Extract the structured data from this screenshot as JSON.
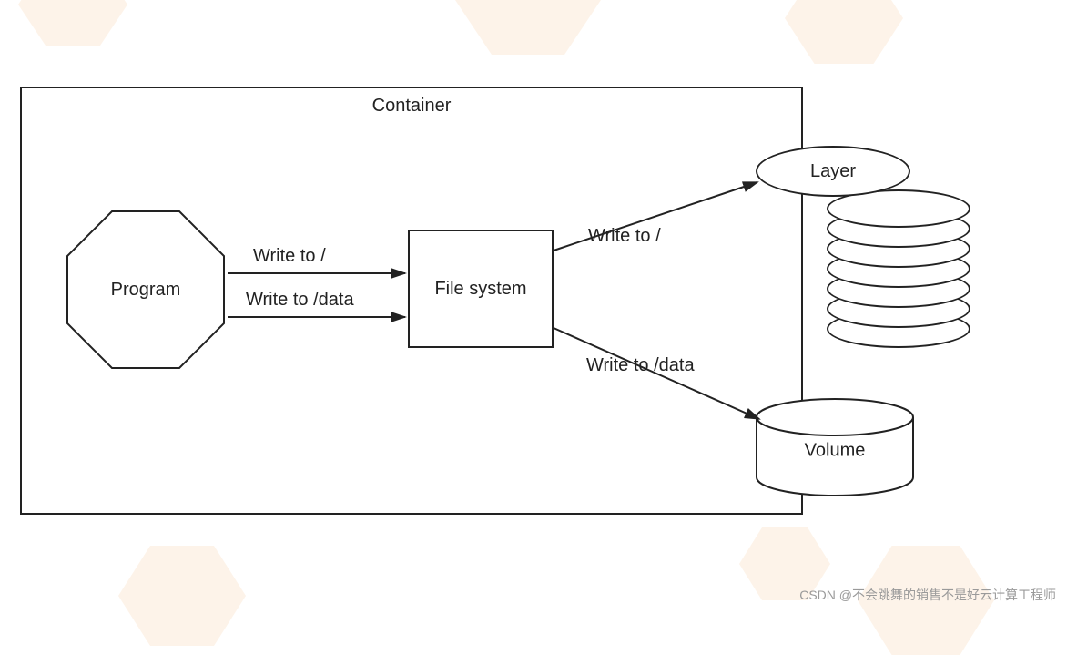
{
  "diagram": {
    "container_label": "Container",
    "nodes": {
      "program": "Program",
      "filesystem": "File system",
      "layer": "Layer",
      "volume": "Volume"
    },
    "edges": {
      "program_to_fs_root": "Write to /",
      "program_to_fs_data": "Write to /data",
      "fs_to_layer": "Write to /",
      "fs_to_volume": "Write to /data"
    }
  },
  "watermark": "CSDN @不会跳舞的销售不是好云计算工程师"
}
